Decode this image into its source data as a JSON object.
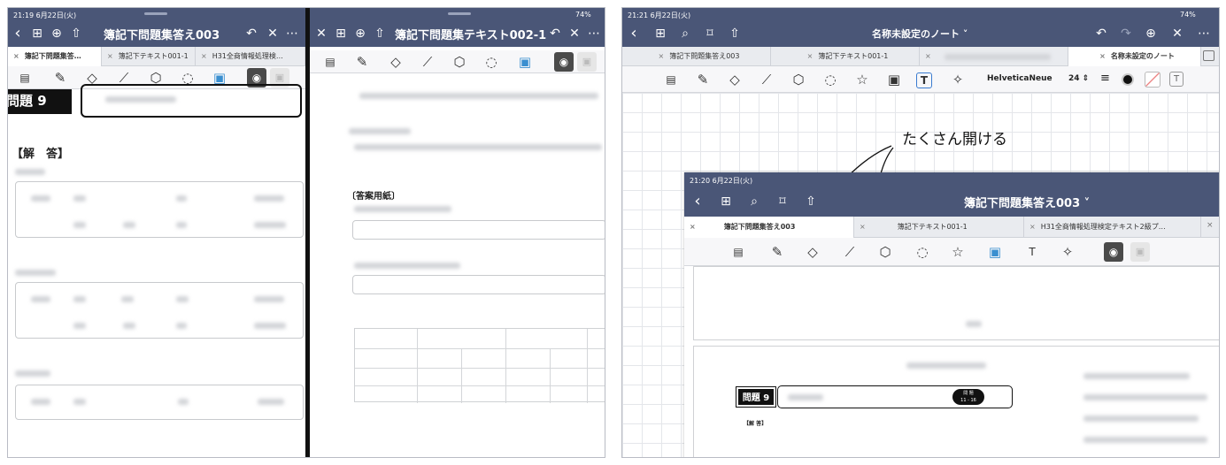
{
  "left_screen": {
    "status_time": "21:19  6月22日(火)",
    "left_pane": {
      "title": "簿記下問題集答え003",
      "tabs": [
        "簿記下問題集答…",
        "簿記下テキスト001-1",
        "H31全商情報処理検…"
      ],
      "problem_label": "問題 9",
      "answer_heading": "【解　答】"
    },
    "right_pane": {
      "title": "簿記下問題集テキスト002-1",
      "battery": "74%",
      "answer_sheet_label": "〔答案用紙〕"
    }
  },
  "right_screen": {
    "status_time": "21:21  6月22日(火)",
    "battery": "74%",
    "title": "名称未設定のノート",
    "tabs": [
      "簿記下問題集答え003",
      "簿記下テキスト001-1",
      "",
      "名称未設定のノート"
    ],
    "font_name": "HelveticaNeue",
    "font_size": "24",
    "callout_text": "たくさん開ける",
    "inset": {
      "status_time": "21:20  6月22日(火)",
      "title": "簿記下問題集答え003",
      "tabs": [
        "簿記下問題集答え003",
        "簿記下テキスト001-1",
        "H31全商情報処理検定テキスト2級プ…"
      ],
      "problem_label": "問題 9",
      "badge_line1": "問 題",
      "badge_line2": "11 - 16",
      "answer_heading": "【解 答】"
    }
  },
  "icons": {
    "back": "‹",
    "grid": "⊞",
    "add": "⊕",
    "share": "⇧",
    "undo": "↶",
    "redo": "↷",
    "close": "✕",
    "more": "⋯",
    "search": "⌕",
    "bookmark": "⌑",
    "pen": "✎",
    "eraser": "◇",
    "highlighter": "⟋",
    "shapes": "⬡",
    "lasso": "◌",
    "star": "☆",
    "image": "▣",
    "text": "T",
    "laser": "✧",
    "camera": "◉",
    "reader": "▤"
  },
  "colors": {
    "navy": "#4a5677",
    "tabbar": "#e9ebef",
    "divider": "#111111"
  }
}
